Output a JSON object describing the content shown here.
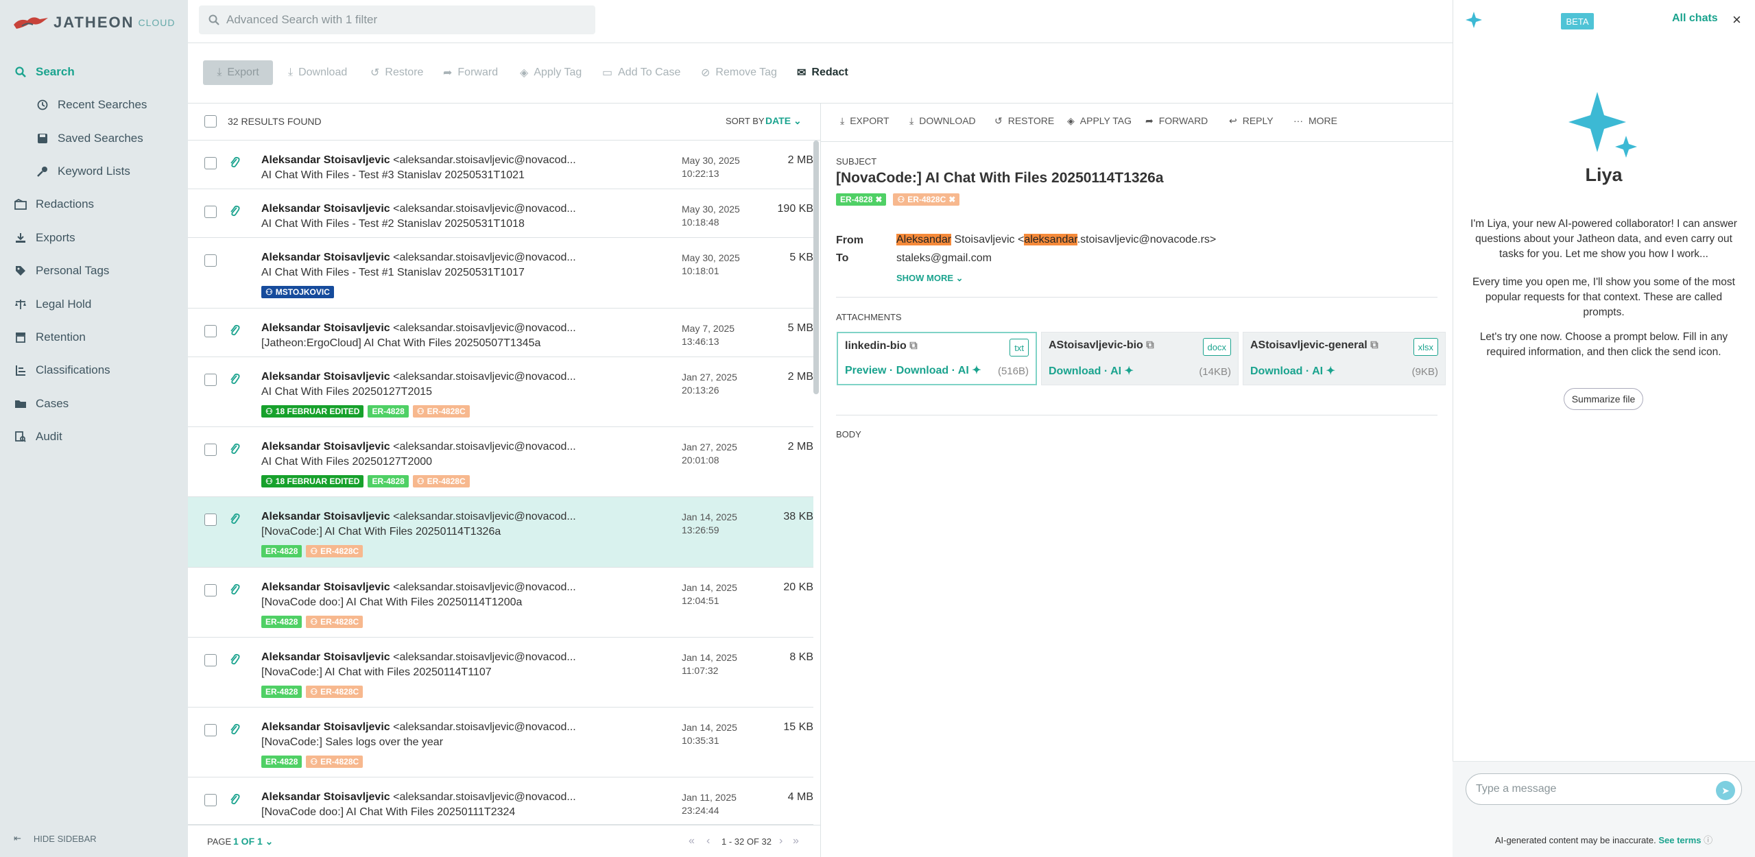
{
  "app": {
    "logo_word": "JATHEON",
    "logo_cloud": "CLOUD"
  },
  "search": {
    "placeholder": "Advanced Search with 1 filter"
  },
  "sidebar": {
    "items": [
      {
        "label": "Search",
        "icon": "search-icon",
        "active": true
      },
      {
        "label": "Recent Searches",
        "icon": "history-icon",
        "sub": true
      },
      {
        "label": "Saved Searches",
        "icon": "save-icon",
        "sub": true
      },
      {
        "label": "Keyword Lists",
        "icon": "key-icon",
        "sub": true
      },
      {
        "label": "Redactions",
        "icon": "redactions-icon"
      },
      {
        "label": "Exports",
        "icon": "export-icon"
      },
      {
        "label": "Personal Tags",
        "icon": "tag-icon"
      },
      {
        "label": "Legal Hold",
        "icon": "scale-icon"
      },
      {
        "label": "Retention",
        "icon": "retention-icon"
      },
      {
        "label": "Classifications",
        "icon": "classifications-icon"
      },
      {
        "label": "Cases",
        "icon": "folder-icon"
      },
      {
        "label": "Audit",
        "icon": "audit-icon"
      }
    ],
    "hide_label": "HIDE SIDEBAR"
  },
  "toolbar": {
    "export": "Export",
    "download": "Download",
    "restore": "Restore",
    "forward": "Forward",
    "apply_tag": "Apply Tag",
    "add_to_case": "Add To Case",
    "remove_tag": "Remove Tag",
    "redact": "Redact"
  },
  "results": {
    "count_label": "32 RESULTS FOUND",
    "sort_label": "SORT BY",
    "sort_value": "DATE",
    "rows": [
      {
        "sender": "Aleksandar Stoisavljevic",
        "email": " <aleksandar.stoisavljevic@novacod...",
        "subject": "AI Chat With Files - Test #3 Stanislav 20250531T1021",
        "date": "May 30, 2025",
        "time": "10:22:13",
        "size": "2 MB"
      },
      {
        "sender": "Aleksandar Stoisavljevic",
        "email": " <aleksandar.stoisavljevic@novacod...",
        "subject": "AI Chat With Files - Test #2 Stanislav 20250531T1018",
        "date": "May 30, 2025",
        "time": "10:18:48",
        "size": "190 KB"
      },
      {
        "sender": "Aleksandar Stoisavljevic",
        "email": " <aleksandar.stoisavljevic@novacod...",
        "subject": "AI Chat With Files - Test #1 Stanislav 20250531T1017",
        "date": "May 30, 2025",
        "time": "10:18:01",
        "size": "5 KB",
        "tag_mstojkovic": "MSTOJKOVIC"
      },
      {
        "sender": "Aleksandar Stoisavljevic",
        "email": " <aleksandar.stoisavljevic@novacod...",
        "subject": "[Jatheon:ErgoCloud] AI Chat With Files 20250507T1345a",
        "date": "May 7, 2025",
        "time": "13:46:13",
        "size": "5 MB"
      },
      {
        "sender": "Aleksandar Stoisavljevic",
        "email": " <aleksandar.stoisavljevic@novacod...",
        "subject": "AI Chat With Files 20250127T2015",
        "date": "Jan 27, 2025",
        "time": "20:13:26",
        "size": "2 MB"
      },
      {
        "sender": "Aleksandar Stoisavljevic",
        "email": " <aleksandar.stoisavljevic@novacod...",
        "subject": "AI Chat With Files 20250127T2000",
        "date": "Jan 27, 2025",
        "time": "20:01:08",
        "size": "2 MB"
      },
      {
        "sender": "Aleksandar Stoisavljevic",
        "email": " <aleksandar.stoisavljevic@novacod...",
        "subject": "[NovaCode:] AI Chat With Files 20250114T1326a",
        "date": "Jan 14, 2025",
        "time": "13:26:59",
        "size": "38 KB"
      },
      {
        "sender": "Aleksandar Stoisavljevic",
        "email": " <aleksandar.stoisavljevic@novacod...",
        "subject": "[NovaCode doo:] AI Chat With Files 20250114T1200a",
        "date": "Jan 14, 2025",
        "time": "12:04:51",
        "size": "20 KB"
      },
      {
        "sender": "Aleksandar Stoisavljevic",
        "email": " <aleksandar.stoisavljevic@novacod...",
        "subject": "[NovaCode:] AI Chat with Files 20250114T1107",
        "date": "Jan 14, 2025",
        "time": "11:07:32",
        "size": "8 KB"
      },
      {
        "sender": "Aleksandar Stoisavljevic",
        "email": " <aleksandar.stoisavljevic@novacod...",
        "subject": "[NovaCode:] Sales logs over the year",
        "date": "Jan 14, 2025",
        "time": "10:35:31",
        "size": "15 KB"
      },
      {
        "sender": "Aleksandar Stoisavljevic",
        "email": " <aleksandar.stoisavljevic@novacod...",
        "subject": "[NovaCode doo:] AI Chat With Files 20250111T2324",
        "date": "Jan 11, 2025",
        "time": "23:24:44",
        "size": "4 MB"
      }
    ],
    "tag_feb": "18 FEBRUAR EDITED",
    "tag_er": "ER-4828",
    "tag_erc": "ER-4828C"
  },
  "pager": {
    "page_label": "PAGE",
    "page_value": "1 OF 1",
    "range": "1 - 32 OF 32"
  },
  "detail": {
    "actions": {
      "export": "EXPORT",
      "download": "DOWNLOAD",
      "restore": "RESTORE",
      "apply_tag": "APPLY TAG",
      "forward": "FORWARD",
      "reply": "REPLY",
      "more": "MORE"
    },
    "subject_label": "SUBJECT",
    "subject": "[NovaCode:] AI Chat With Files 20250114T1326a",
    "tag1": "ER-4828",
    "tag2": "ER-4828C",
    "from_label": "From",
    "from_hl1": "Aleksandar",
    "from_mid": " Stoisavljevic <",
    "from_hl2": "aleksandar",
    "from_rest": ".stoisavljevic@novacode.rs>",
    "to_label": "To",
    "to": "staleks@gmail.com",
    "show_more": "SHOW MORE",
    "attachments_label": "ATTACHMENTS",
    "attachments": [
      {
        "name": "linkedin-bio",
        "ext": "txt",
        "actions": "Preview · Download · AI",
        "size": "(516B)"
      },
      {
        "name": "AStoisavljevic-bio",
        "ext": "docx",
        "actions": "Download · AI",
        "size": "(14KB)"
      },
      {
        "name": "AStoisavljevic-general",
        "ext": "xlsx",
        "actions": "Download · AI",
        "size": "(9KB)"
      }
    ],
    "body_label": "BODY"
  },
  "chat": {
    "beta": "BETA",
    "all_chats": "All chats",
    "name": "Liya",
    "p1": "I'm Liya, your new AI-powered collaborator! I can answer questions about your Jatheon data, and even carry out tasks for you. Let me show you how I work...",
    "p2": "Every time you open me, I'll show you some of the most popular requests for that context. These are called prompts.",
    "p3": "Let's try one now. Choose a prompt below. Fill in any required information, and then click the send icon.",
    "suggestion": "Summarize file",
    "input_placeholder": "Type a message",
    "disclaimer": "AI-generated content may be inaccurate.",
    "see_terms": "See terms"
  },
  "colors": {
    "accent": "#1aa38e",
    "sidebar_bg": "#e2e8ea",
    "beta": "#4fc3d6",
    "highlight": "#f58a3a"
  }
}
